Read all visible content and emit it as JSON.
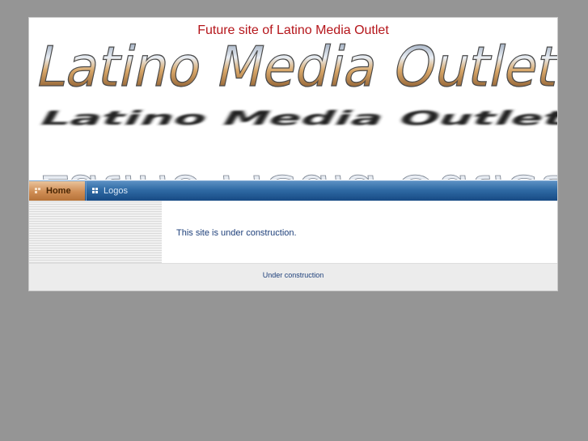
{
  "header": {
    "tagline": "Future site of Latino Media Outlet",
    "logo_text": "Latino Media Outlet"
  },
  "nav": {
    "items": [
      {
        "label": "Home",
        "active": true
      },
      {
        "label": "Logos",
        "active": false
      }
    ]
  },
  "main": {
    "message": "This site is under construction."
  },
  "footer": {
    "text": "Under construction"
  },
  "colors": {
    "background": "#959595",
    "tagline": "#b5161b",
    "nav_blue": "#2f6aa4",
    "nav_active": "#cf8d54",
    "body_text": "#1d3f7a"
  }
}
